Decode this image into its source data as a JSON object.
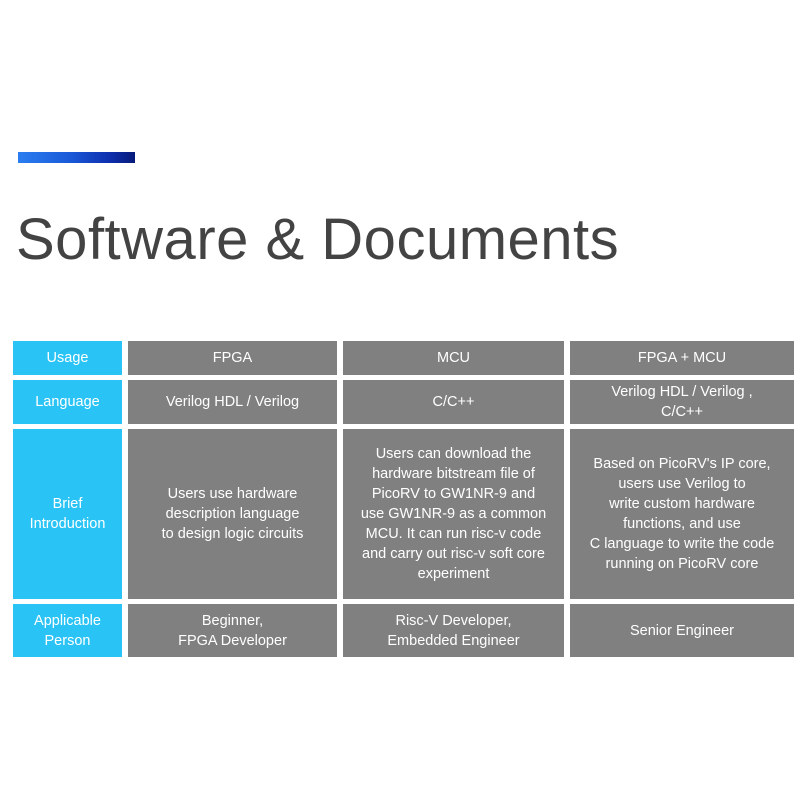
{
  "accent": {
    "gradient_start": "#2b7ef0",
    "gradient_end": "#061a7a"
  },
  "colors": {
    "header_cell": "#29c3f5",
    "data_cell": "#808080",
    "title_text": "#434343",
    "cell_text": "#ffffff",
    "background": "#ffffff"
  },
  "header": {
    "title": "Software & Documents"
  },
  "table": {
    "row_labels": [
      "Usage",
      "Language",
      "Brief\nIntroduction",
      "Applicable\nPerson"
    ],
    "columns": [
      "FPGA",
      "MCU",
      "FPGA + MCU"
    ],
    "rows": [
      {
        "label": "Usage",
        "cells": [
          "FPGA",
          "MCU",
          "FPGA + MCU"
        ]
      },
      {
        "label": "Language",
        "cells": [
          "Verilog HDL / Verilog",
          "C/C++",
          "Verilog HDL / Verilog ,\nC/C++"
        ]
      },
      {
        "label": "Brief\nIntroduction",
        "cells": [
          "Users use hardware\ndescription language\nto design logic circuits",
          "Users can download the\nhardware bitstream file of\nPicoRV to GW1NR-9 and\nuse GW1NR-9 as a common\nMCU. It can run risc-v code\nand carry out risc-v soft core\nexperiment",
          "Based on PicoRV's IP core,\nusers use Verilog to\nwrite custom hardware\nfunctions, and use\nC language to write the code\nrunning on PicoRV core"
        ]
      },
      {
        "label": "Applicable\nPerson",
        "cells": [
          "Beginner,\nFPGA Developer",
          "Risc-V Developer,\nEmbedded Engineer",
          "Senior Engineer"
        ]
      }
    ]
  }
}
